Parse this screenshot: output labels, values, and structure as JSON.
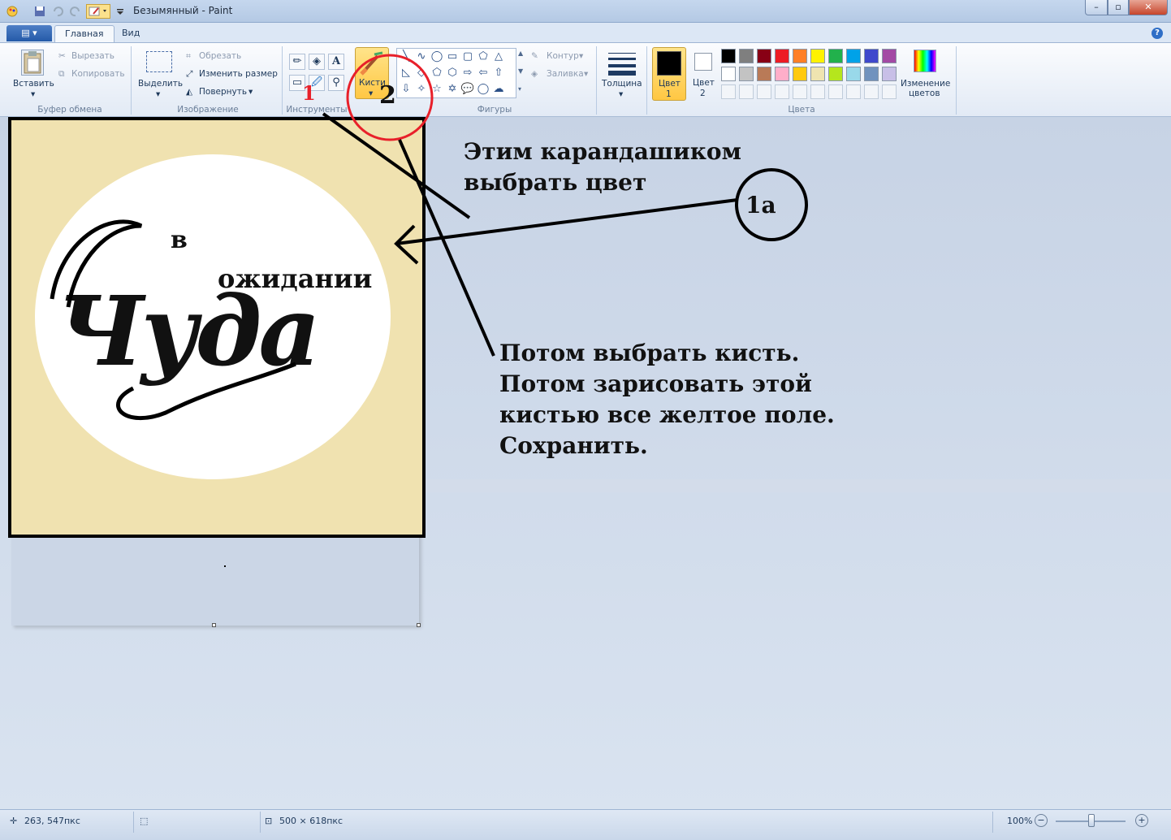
{
  "window": {
    "title": "Безымянный - Paint"
  },
  "tabs": {
    "home": "Главная",
    "view": "Вид"
  },
  "ribbon": {
    "clipboard": {
      "paste": "Вставить",
      "cut": "Вырезать",
      "copy": "Копировать",
      "label": "Буфер обмена"
    },
    "image": {
      "select": "Выделить",
      "crop": "Обрезать",
      "resize": "Изменить размер",
      "rotate": "Повернуть",
      "label": "Изображение"
    },
    "tools": {
      "label": "Инструменты",
      "text_glyph": "A"
    },
    "brushes": {
      "label": "Кисти"
    },
    "shapes": {
      "outline": "Контур",
      "fill": "Заливка",
      "label": "Фигуры"
    },
    "size": {
      "label": "Толщина"
    },
    "colors": {
      "color1_l1": "Цвет",
      "color1_l2": "1",
      "color2_l1": "Цвет",
      "color2_l2": "2",
      "edit_l1": "Изменение",
      "edit_l2": "цветов",
      "label": "Цвета",
      "row1": [
        "#000000",
        "#7f7f7f",
        "#880015",
        "#ed1c24",
        "#ff7f27",
        "#fff200",
        "#22b14c",
        "#00a2e8",
        "#3f48cc",
        "#a349a4"
      ],
      "row2": [
        "#ffffff",
        "#c3c3c3",
        "#b97a57",
        "#ffaec9",
        "#ffc90e",
        "#efe4b0",
        "#b5e61d",
        "#99d9ea",
        "#7092be",
        "#c8bfe7"
      ]
    }
  },
  "image": {
    "word_v": "в",
    "word_ozhidanii": "ожидании",
    "word_chuda": "Чуда"
  },
  "annotations": {
    "num1": "1",
    "num2": "2",
    "num1a": "1а",
    "pencil_l1": "Этим карандашиком",
    "pencil_l2": "выбрать цвет",
    "brush_l1": "Потом выбрать кисть.",
    "brush_l2": "Потом зарисовать этой",
    "brush_l3": "кистью все желтое поле.",
    "brush_l4": "Сохранить."
  },
  "status": {
    "cursor": "263, 547пкс",
    "size": "500 × 618пкс",
    "zoom": "100%"
  }
}
